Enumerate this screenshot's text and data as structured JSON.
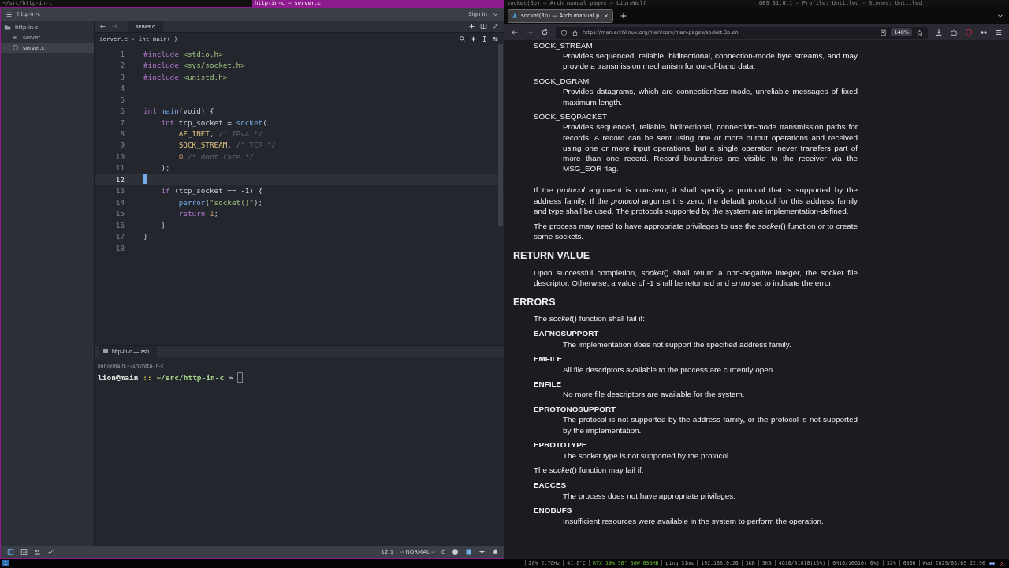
{
  "top_bar": {
    "segments": [
      {
        "text": "~/src/http-in-c",
        "selected": false
      },
      {
        "text": "http-in-c — server.c",
        "selected": true
      },
      {
        "text": "socket(3p) — Arch manual pages — LibreWolf",
        "selected": false
      },
      {
        "text": "OBS 31.0.1 - Profile: Untitled - Scenes: Untitled",
        "selected": false
      }
    ]
  },
  "editor": {
    "project": "http-in-c",
    "sign_in": "Sign in",
    "tree": [
      {
        "label": "http-in-c",
        "kind": "folder",
        "selected": false,
        "children": [
          {
            "label": "server",
            "kind": "binary",
            "selected": false
          },
          {
            "label": "server.c",
            "kind": "source",
            "selected": true
          }
        ]
      }
    ],
    "tabs": [
      {
        "label": "server.c",
        "selected": true
      }
    ],
    "breadcrumb": "server.c › int main( )",
    "lines": [
      {
        "number": "1",
        "current": false,
        "tokens": [
          {
            "text": "#include",
            "kind": "keyword"
          },
          {
            "text": " <stdio.h>",
            "kind": "string"
          }
        ]
      },
      {
        "number": "2",
        "current": false,
        "tokens": [
          {
            "text": "#include",
            "kind": "keyword"
          },
          {
            "text": " <sys/socket.h>",
            "kind": "string"
          }
        ]
      },
      {
        "number": "3",
        "current": false,
        "tokens": [
          {
            "text": "#include",
            "kind": "keyword"
          },
          {
            "text": " <unistd.h>",
            "kind": "string"
          }
        ]
      },
      {
        "number": "4",
        "current": false
      },
      {
        "number": "5",
        "current": false
      },
      {
        "number": "6",
        "current": false,
        "tokens": [
          {
            "text": "int ",
            "kind": "keyword"
          },
          {
            "text": "main",
            "kind": "function"
          },
          {
            "text": "(void) {",
            "kind": "plain"
          }
        ]
      },
      {
        "number": "7",
        "current": false,
        "tokens": [
          {
            "text": "    int",
            "kind": "keyword"
          },
          {
            "text": " tcp_socket = ",
            "kind": "plain"
          },
          {
            "text": "socket",
            "kind": "function"
          },
          {
            "text": "(",
            "kind": "plain"
          }
        ]
      },
      {
        "number": "8",
        "current": false,
        "tokens": [
          {
            "text": "        AF_INET",
            "kind": "constant"
          },
          {
            "text": ", ",
            "kind": "plain"
          },
          {
            "text": "/* IPv4 */",
            "kind": "comment"
          }
        ]
      },
      {
        "number": "9",
        "current": false,
        "tokens": [
          {
            "text": "        SOCK_STREAM",
            "kind": "constant"
          },
          {
            "text": ", ",
            "kind": "plain"
          },
          {
            "text": "/* TCP */",
            "kind": "comment"
          }
        ]
      },
      {
        "number": "10",
        "current": false,
        "tokens": [
          {
            "text": "        0",
            "kind": "number"
          },
          {
            "text": " /* dont care */",
            "kind": "comment"
          }
        ]
      },
      {
        "number": "11",
        "current": false,
        "tokens": [
          {
            "text": "    );",
            "kind": "plain"
          }
        ]
      },
      {
        "number": "12",
        "current": true
      },
      {
        "number": "13",
        "current": false,
        "tokens": [
          {
            "text": "    if",
            "kind": "keyword"
          },
          {
            "text": " (tcp_socket == -1) {",
            "kind": "plain"
          }
        ]
      },
      {
        "number": "14",
        "current": false,
        "tokens": [
          {
            "text": "        perror",
            "kind": "function"
          },
          {
            "text": "(",
            "kind": "plain"
          },
          {
            "text": "\"socket()\"",
            "kind": "string"
          },
          {
            "text": ");",
            "kind": "plain"
          }
        ]
      },
      {
        "number": "15",
        "current": false,
        "tokens": [
          {
            "text": "        return",
            "kind": "keyword"
          },
          {
            "text": " 1",
            "kind": "number"
          },
          {
            "text": ";",
            "kind": "plain"
          }
        ]
      },
      {
        "number": "16",
        "current": false,
        "tokens": [
          {
            "text": "    }",
            "kind": "plain"
          }
        ]
      },
      {
        "number": "17",
        "current": false,
        "tokens": [
          {
            "text": "}",
            "kind": "plain"
          }
        ]
      },
      {
        "number": "18",
        "current": false
      }
    ],
    "terminal": {
      "tab": "http-in-c — zsh",
      "title": "lion@main:~/src/http-in-c",
      "prompt": [
        {
          "text": "lion@main",
          "kind": "user"
        },
        {
          "text": " :: ",
          "kind": "separator"
        },
        {
          "text": "~/src/http-in-c",
          "kind": "path"
        },
        {
          "text": " »",
          "kind": "arrow"
        }
      ]
    },
    "status": {
      "position": "12:1",
      "mode": "-- NORMAL --",
      "language": "C"
    }
  },
  "browser": {
    "tabs": [
      {
        "title": "socket(3p) — Arch manual p",
        "selected": true
      }
    ],
    "url": "https://man.archlinux.org/man/core/man-pages/socket.3p.en",
    "zoom": "140%",
    "content": [
      {
        "kind": "term",
        "term": "SOCK_STREAM",
        "desc": "Provides sequenced, reliable, bidirectional, connection-mode byte streams, and may provide a transmission mechanism for out-of-band data."
      },
      {
        "kind": "term",
        "term": "SOCK_DGRAM",
        "desc": "Provides datagrams, which are connectionless-mode, unreliable messages of fixed maximum length."
      },
      {
        "kind": "term",
        "term": "SOCK_SEQPACKET",
        "desc": "Provides sequenced, reliable, bidirectional, connection-mode transmission paths for records. A record can be sent using one or more output operations and received using one or more input operations, but a single operation never transfers part of more than one record. Record boundaries are visible to the receiver via the MSG_EOR flag."
      },
      {
        "kind": "para",
        "text": "If the *protocol* argument is non-zero, it shall specify a protocol that is supported by the address family. If the *protocol* argument is zero, the default protocol for this address family and type shall be used. The protocols supported by the system are implementation-defined."
      },
      {
        "kind": "para",
        "text": "The process may need to have appropriate privileges to use the *socket*() function or to create some sockets."
      },
      {
        "kind": "heading",
        "text": "RETURN VALUE"
      },
      {
        "kind": "para",
        "text": "Upon successful completion, *socket*() shall return a non-negative integer, the socket file descriptor. Otherwise, a value of -1 shall be returned and *errno* set to indicate the error."
      },
      {
        "kind": "heading",
        "text": "ERRORS"
      },
      {
        "kind": "para",
        "text": "The *socket*() function shall fail if:"
      },
      {
        "kind": "error",
        "term": "EAFNOSUPPORT",
        "desc": "The implementation does not support the specified address family."
      },
      {
        "kind": "error",
        "term": "EMFILE",
        "desc": "All file descriptors available to the process are currently open."
      },
      {
        "kind": "error",
        "term": "ENFILE",
        "desc": "No more file descriptors are available for the system."
      },
      {
        "kind": "error",
        "term": "EPROTONOSUPPORT",
        "desc": "The protocol is not supported by the address family, or the protocol is not supported by the implementation."
      },
      {
        "kind": "error",
        "term": "EPROTOTYPE",
        "desc": "The socket type is not supported by the protocol."
      },
      {
        "kind": "para",
        "text": "The *socket*() function may fail if:"
      },
      {
        "kind": "error",
        "term": "EACCES",
        "desc": "The process does not have appropriate privileges."
      },
      {
        "kind": "error",
        "term": "ENOBUFS",
        "desc": "Insufficient resources were available in the system to perform the operation."
      }
    ]
  },
  "system_bar": {
    "workspaces": [
      {
        "label": "1",
        "selected": true
      }
    ],
    "stats": [
      {
        "text": "28% 2.7GHz",
        "kind": "normal"
      },
      {
        "text": "41.0°C",
        "kind": "normal"
      },
      {
        "text": "RTX 19% 56° 50W 658MB",
        "kind": "highlight"
      },
      {
        "text": "ping 31ms",
        "kind": "normal"
      },
      {
        "text": "192.168.0.20",
        "kind": "normal"
      },
      {
        "text": "3KB",
        "kind": "normal"
      },
      {
        "text": "3KB",
        "kind": "normal"
      },
      {
        "text": "4G10/31G10(13%)",
        "kind": "normal"
      },
      {
        "text": "0M10/16G10( 0%)",
        "kind": "normal"
      },
      {
        "text": "32%",
        "kind": "normal"
      },
      {
        "text": "6500",
        "kind": "normal"
      },
      {
        "text": "Wed 2025/03/05 22:56",
        "kind": "normal"
      }
    ]
  }
}
